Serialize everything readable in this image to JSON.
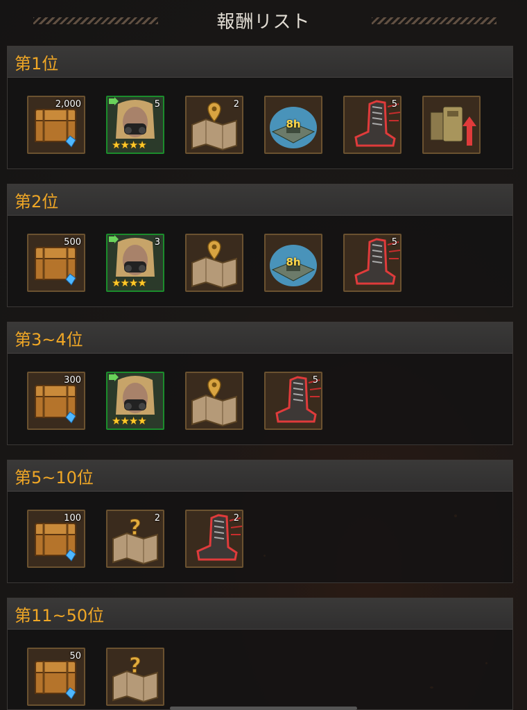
{
  "header": {
    "title": "報酬リスト"
  },
  "sections": [
    {
      "label": "第1位",
      "items": [
        {
          "type": "chest",
          "count": "2,000"
        },
        {
          "type": "hero",
          "count": "5"
        },
        {
          "type": "map-pin",
          "count": "2"
        },
        {
          "type": "dome",
          "badge": "8h"
        },
        {
          "type": "boot",
          "count": "5"
        },
        {
          "type": "upgrade",
          "count": ""
        }
      ]
    },
    {
      "label": "第2位",
      "items": [
        {
          "type": "chest",
          "count": "500"
        },
        {
          "type": "hero",
          "count": "3"
        },
        {
          "type": "map-pin",
          "count": ""
        },
        {
          "type": "dome",
          "badge": "8h"
        },
        {
          "type": "boot",
          "count": "5"
        }
      ]
    },
    {
      "label": "第3~4位",
      "items": [
        {
          "type": "chest",
          "count": "300"
        },
        {
          "type": "hero",
          "count": ""
        },
        {
          "type": "map-pin",
          "count": ""
        },
        {
          "type": "boot",
          "count": "5"
        }
      ]
    },
    {
      "label": "第5~10位",
      "items": [
        {
          "type": "chest",
          "count": "100"
        },
        {
          "type": "map-question",
          "count": "2"
        },
        {
          "type": "boot",
          "count": "2"
        }
      ]
    },
    {
      "label": "第11~50位",
      "items": [
        {
          "type": "chest",
          "count": "50"
        },
        {
          "type": "map-question",
          "count": ""
        }
      ]
    }
  ],
  "colors": {
    "accent": "#f0a726",
    "hero_border": "#1b8d2c"
  },
  "hero_stars": "★★★★"
}
